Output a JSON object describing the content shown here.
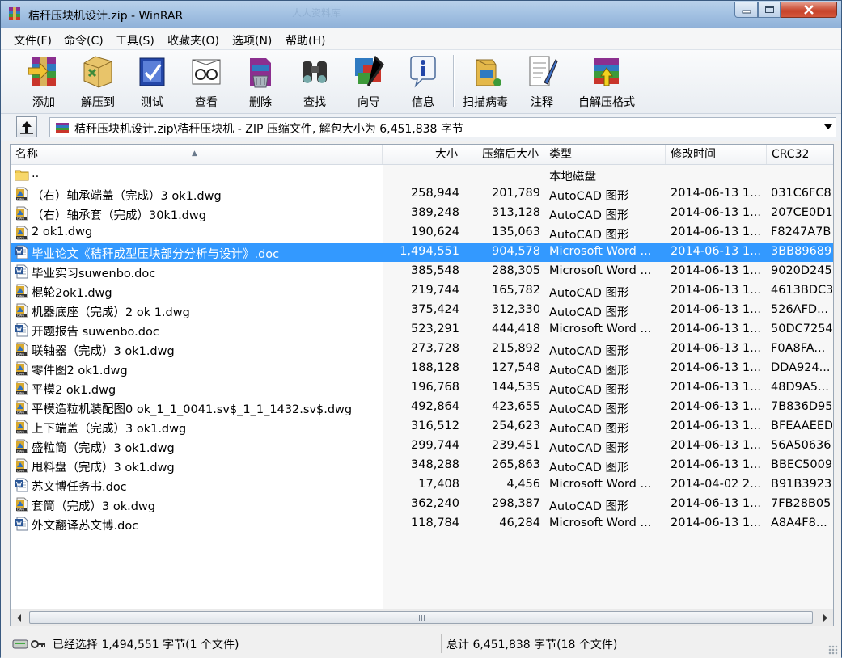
{
  "window": {
    "title": "秸秆压块机设计.zip - WinRAR",
    "watermark": "人人资料库"
  },
  "menu": [
    "文件(F)",
    "命令(C)",
    "工具(S)",
    "收藏夹(O)",
    "选项(N)",
    "帮助(H)"
  ],
  "toolbar": [
    {
      "label": "添加",
      "icon": "add-archive-icon"
    },
    {
      "label": "解压到",
      "icon": "extract-to-icon"
    },
    {
      "label": "测试",
      "icon": "test-icon"
    },
    {
      "label": "查看",
      "icon": "view-icon"
    },
    {
      "label": "删除",
      "icon": "delete-icon"
    },
    {
      "label": "查找",
      "icon": "find-icon"
    },
    {
      "label": "向导",
      "icon": "wizard-icon"
    },
    {
      "label": "信息",
      "icon": "info-icon"
    },
    {
      "label": "扫描病毒",
      "icon": "virus-scan-icon"
    },
    {
      "label": "注释",
      "icon": "comment-icon"
    },
    {
      "label": "自解压格式",
      "icon": "sfx-icon"
    }
  ],
  "address": {
    "path": "秸秆压块机设计.zip\\秸秆压块机 - ZIP 压缩文件, 解包大小为 6,451,838 字节"
  },
  "columns": {
    "name": "名称",
    "size": "大小",
    "packed": "压缩后大小",
    "type": "类型",
    "modified": "修改时间",
    "crc": "CRC32"
  },
  "files": [
    {
      "name": "..",
      "size": "",
      "packed": "",
      "type": "本地磁盘",
      "modified": "",
      "crc": "",
      "icon": "folder-up-icon"
    },
    {
      "name": "（右）轴承端盖（完成）3 ok1.dwg",
      "size": "258,944",
      "packed": "201,789",
      "type": "AutoCAD 图形",
      "modified": "2014-06-13 1...",
      "crc": "031C6FC8",
      "icon": "dwg-file-icon"
    },
    {
      "name": "（右）轴承套（完成）30k1.dwg",
      "size": "389,248",
      "packed": "313,128",
      "type": "AutoCAD 图形",
      "modified": "2014-06-13 1...",
      "crc": "207CE0D1",
      "icon": "dwg-file-icon"
    },
    {
      "name": "2 ok1.dwg",
      "size": "190,624",
      "packed": "135,063",
      "type": "AutoCAD 图形",
      "modified": "2014-06-13 1...",
      "crc": "F8247A7B",
      "icon": "dwg-file-icon"
    },
    {
      "name": "毕业论文《秸秆成型压块部分分析与设计》.doc",
      "size": "1,494,551",
      "packed": "904,578",
      "type": "Microsoft Word ...",
      "modified": "2014-06-13 1...",
      "crc": "3BB89689",
      "icon": "doc-file-icon",
      "selected": true
    },
    {
      "name": "毕业实习suwenbo.doc",
      "size": "385,548",
      "packed": "288,305",
      "type": "Microsoft Word ...",
      "modified": "2014-06-13 1...",
      "crc": "9020D245",
      "icon": "doc-file-icon"
    },
    {
      "name": "棍轮2ok1.dwg",
      "size": "219,744",
      "packed": "165,782",
      "type": "AutoCAD 图形",
      "modified": "2014-06-13 1...",
      "crc": "4613BDC3",
      "icon": "dwg-file-icon"
    },
    {
      "name": "机器底座（完成）2 ok 1.dwg",
      "size": "375,424",
      "packed": "312,330",
      "type": "AutoCAD 图形",
      "modified": "2014-06-13 1...",
      "crc": "526AFD...",
      "icon": "dwg-file-icon"
    },
    {
      "name": "开题报告  suwenbo.doc",
      "size": "523,291",
      "packed": "444,418",
      "type": "Microsoft Word ...",
      "modified": "2014-06-13 1...",
      "crc": "50DC7254",
      "icon": "doc-file-icon"
    },
    {
      "name": "联轴器（完成）3 ok1.dwg",
      "size": "273,728",
      "packed": "215,892",
      "type": "AutoCAD 图形",
      "modified": "2014-06-13 1...",
      "crc": "F0A8FA...",
      "icon": "dwg-file-icon"
    },
    {
      "name": "零件图2 ok1.dwg",
      "size": "188,128",
      "packed": "127,548",
      "type": "AutoCAD 图形",
      "modified": "2014-06-13 1...",
      "crc": "DDA924...",
      "icon": "dwg-file-icon"
    },
    {
      "name": "平模2   ok1.dwg",
      "size": "196,768",
      "packed": "144,535",
      "type": "AutoCAD 图形",
      "modified": "2014-06-13 1...",
      "crc": "48D9A5...",
      "icon": "dwg-file-icon"
    },
    {
      "name": "平模造粒机装配图0 ok_1_1_0041.sv$_1_1_1432.sv$.dwg",
      "size": "492,864",
      "packed": "423,655",
      "type": "AutoCAD 图形",
      "modified": "2014-06-13 1...",
      "crc": "7B836D95",
      "icon": "dwg-file-icon"
    },
    {
      "name": "上下端盖（完成）3 ok1.dwg",
      "size": "316,512",
      "packed": "254,623",
      "type": "AutoCAD 图形",
      "modified": "2014-06-13 1...",
      "crc": "BFEAAEED",
      "icon": "dwg-file-icon"
    },
    {
      "name": "盛粒筒（完成）3 ok1.dwg",
      "size": "299,744",
      "packed": "239,451",
      "type": "AutoCAD 图形",
      "modified": "2014-06-13 1...",
      "crc": "56A50636",
      "icon": "dwg-file-icon"
    },
    {
      "name": "甩料盘（完成）3  ok1.dwg",
      "size": "348,288",
      "packed": "265,863",
      "type": "AutoCAD 图形",
      "modified": "2014-06-13 1...",
      "crc": "BBEC5009",
      "icon": "dwg-file-icon"
    },
    {
      "name": "苏文博任务书.doc",
      "size": "17,408",
      "packed": "4,456",
      "type": "Microsoft Word ...",
      "modified": "2014-04-02 2...",
      "crc": "B91B3923",
      "icon": "doc-file-icon"
    },
    {
      "name": "套筒（完成）3 ok.dwg",
      "size": "362,240",
      "packed": "298,387",
      "type": "AutoCAD 图形",
      "modified": "2014-06-13 1...",
      "crc": "7FB28B05",
      "icon": "dwg-file-icon"
    },
    {
      "name": "外文翻译苏文博.doc",
      "size": "118,784",
      "packed": "46,284",
      "type": "Microsoft Word ...",
      "modified": "2014-06-13 1...",
      "crc": "A8A4F8...",
      "icon": "doc-file-icon"
    }
  ],
  "status": {
    "selected": "已经选择 1,494,551 字节(1 个文件)",
    "total": "总计 6,451,838 字节(18 个文件)"
  },
  "colors": {
    "selection": "#3399ff",
    "title_gradient_top": "#b9d1ea"
  }
}
